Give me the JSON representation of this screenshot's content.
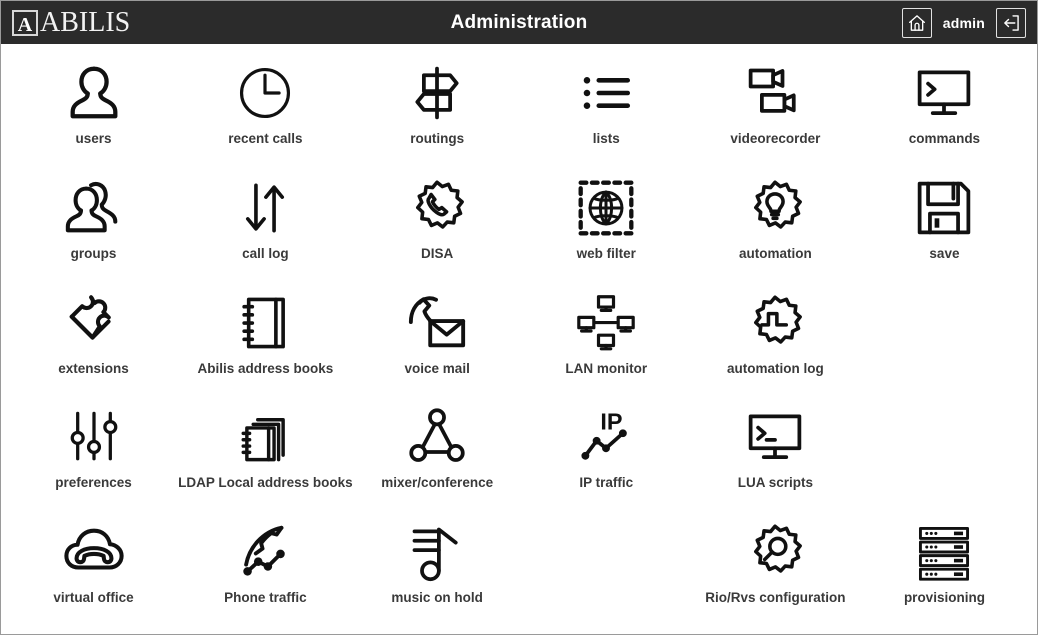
{
  "header": {
    "logo_letter": "A",
    "logo_word": "ABILIS",
    "title": "Administration",
    "home_icon": "home-icon",
    "user_label": "admin",
    "logout_icon": "logout-icon"
  },
  "colors": {
    "header_background": "#2b2b2b",
    "page_background": "#ffffff",
    "label_text": "#3a3a3a",
    "icon_stroke": "#111111",
    "border": "#9a9a9a"
  },
  "grid": {
    "columns": 6,
    "rows": 5,
    "items": [
      {
        "label": "users",
        "icon": "user-icon",
        "empty": false
      },
      {
        "label": "recent calls",
        "icon": "clock-icon",
        "empty": false
      },
      {
        "label": "routings",
        "icon": "signpost-icon",
        "empty": false
      },
      {
        "label": "lists",
        "icon": "bullet-list-icon",
        "empty": false
      },
      {
        "label": "videorecorder",
        "icon": "video-camera-icon",
        "empty": false
      },
      {
        "label": "commands",
        "icon": "monitor-prompt-icon",
        "empty": false
      },
      {
        "label": "groups",
        "icon": "users-group-icon",
        "empty": false
      },
      {
        "label": "call log",
        "icon": "arrows-updown-icon",
        "empty": false
      },
      {
        "label": "DISA",
        "icon": "gear-phone-icon",
        "empty": false
      },
      {
        "label": "web filter",
        "icon": "globe-dashed-icon",
        "empty": false
      },
      {
        "label": "automation",
        "icon": "gear-bulb-icon",
        "empty": false
      },
      {
        "label": "save",
        "icon": "floppy-disk-icon",
        "empty": false
      },
      {
        "label": "extensions",
        "icon": "puzzle-piece-icon",
        "empty": false
      },
      {
        "label": "Abilis address books",
        "icon": "notebook-icon",
        "empty": false
      },
      {
        "label": "voice mail",
        "icon": "handset-envelope-icon",
        "empty": false
      },
      {
        "label": "LAN monitor",
        "icon": "network-monitors-icon",
        "empty": false
      },
      {
        "label": "automation log",
        "icon": "gear-pulse-icon",
        "empty": false
      },
      {
        "label": "",
        "icon": "",
        "empty": true
      },
      {
        "label": "preferences",
        "icon": "sliders-icon",
        "empty": false
      },
      {
        "label": "LDAP Local address books",
        "icon": "notebooks-stack-icon",
        "empty": false
      },
      {
        "label": "mixer/conference",
        "icon": "triangle-nodes-icon",
        "empty": false
      },
      {
        "label": "IP traffic",
        "icon": "ip-graph-icon",
        "empty": false
      },
      {
        "label": "LUA scripts",
        "icon": "monitor-prompt-icon",
        "empty": false
      },
      {
        "label": "",
        "icon": "",
        "empty": true
      },
      {
        "label": "virtual office",
        "icon": "cloud-handset-icon",
        "empty": false
      },
      {
        "label": "Phone traffic",
        "icon": "handset-graph-icon",
        "empty": false
      },
      {
        "label": "music on hold",
        "icon": "music-note-icon",
        "empty": false
      },
      {
        "label": "",
        "icon": "",
        "empty": true
      },
      {
        "label": "Rio/Rvs configuration",
        "icon": "gear-magnifier-icon",
        "empty": false
      },
      {
        "label": "provisioning",
        "icon": "server-racks-icon",
        "empty": false
      }
    ]
  }
}
